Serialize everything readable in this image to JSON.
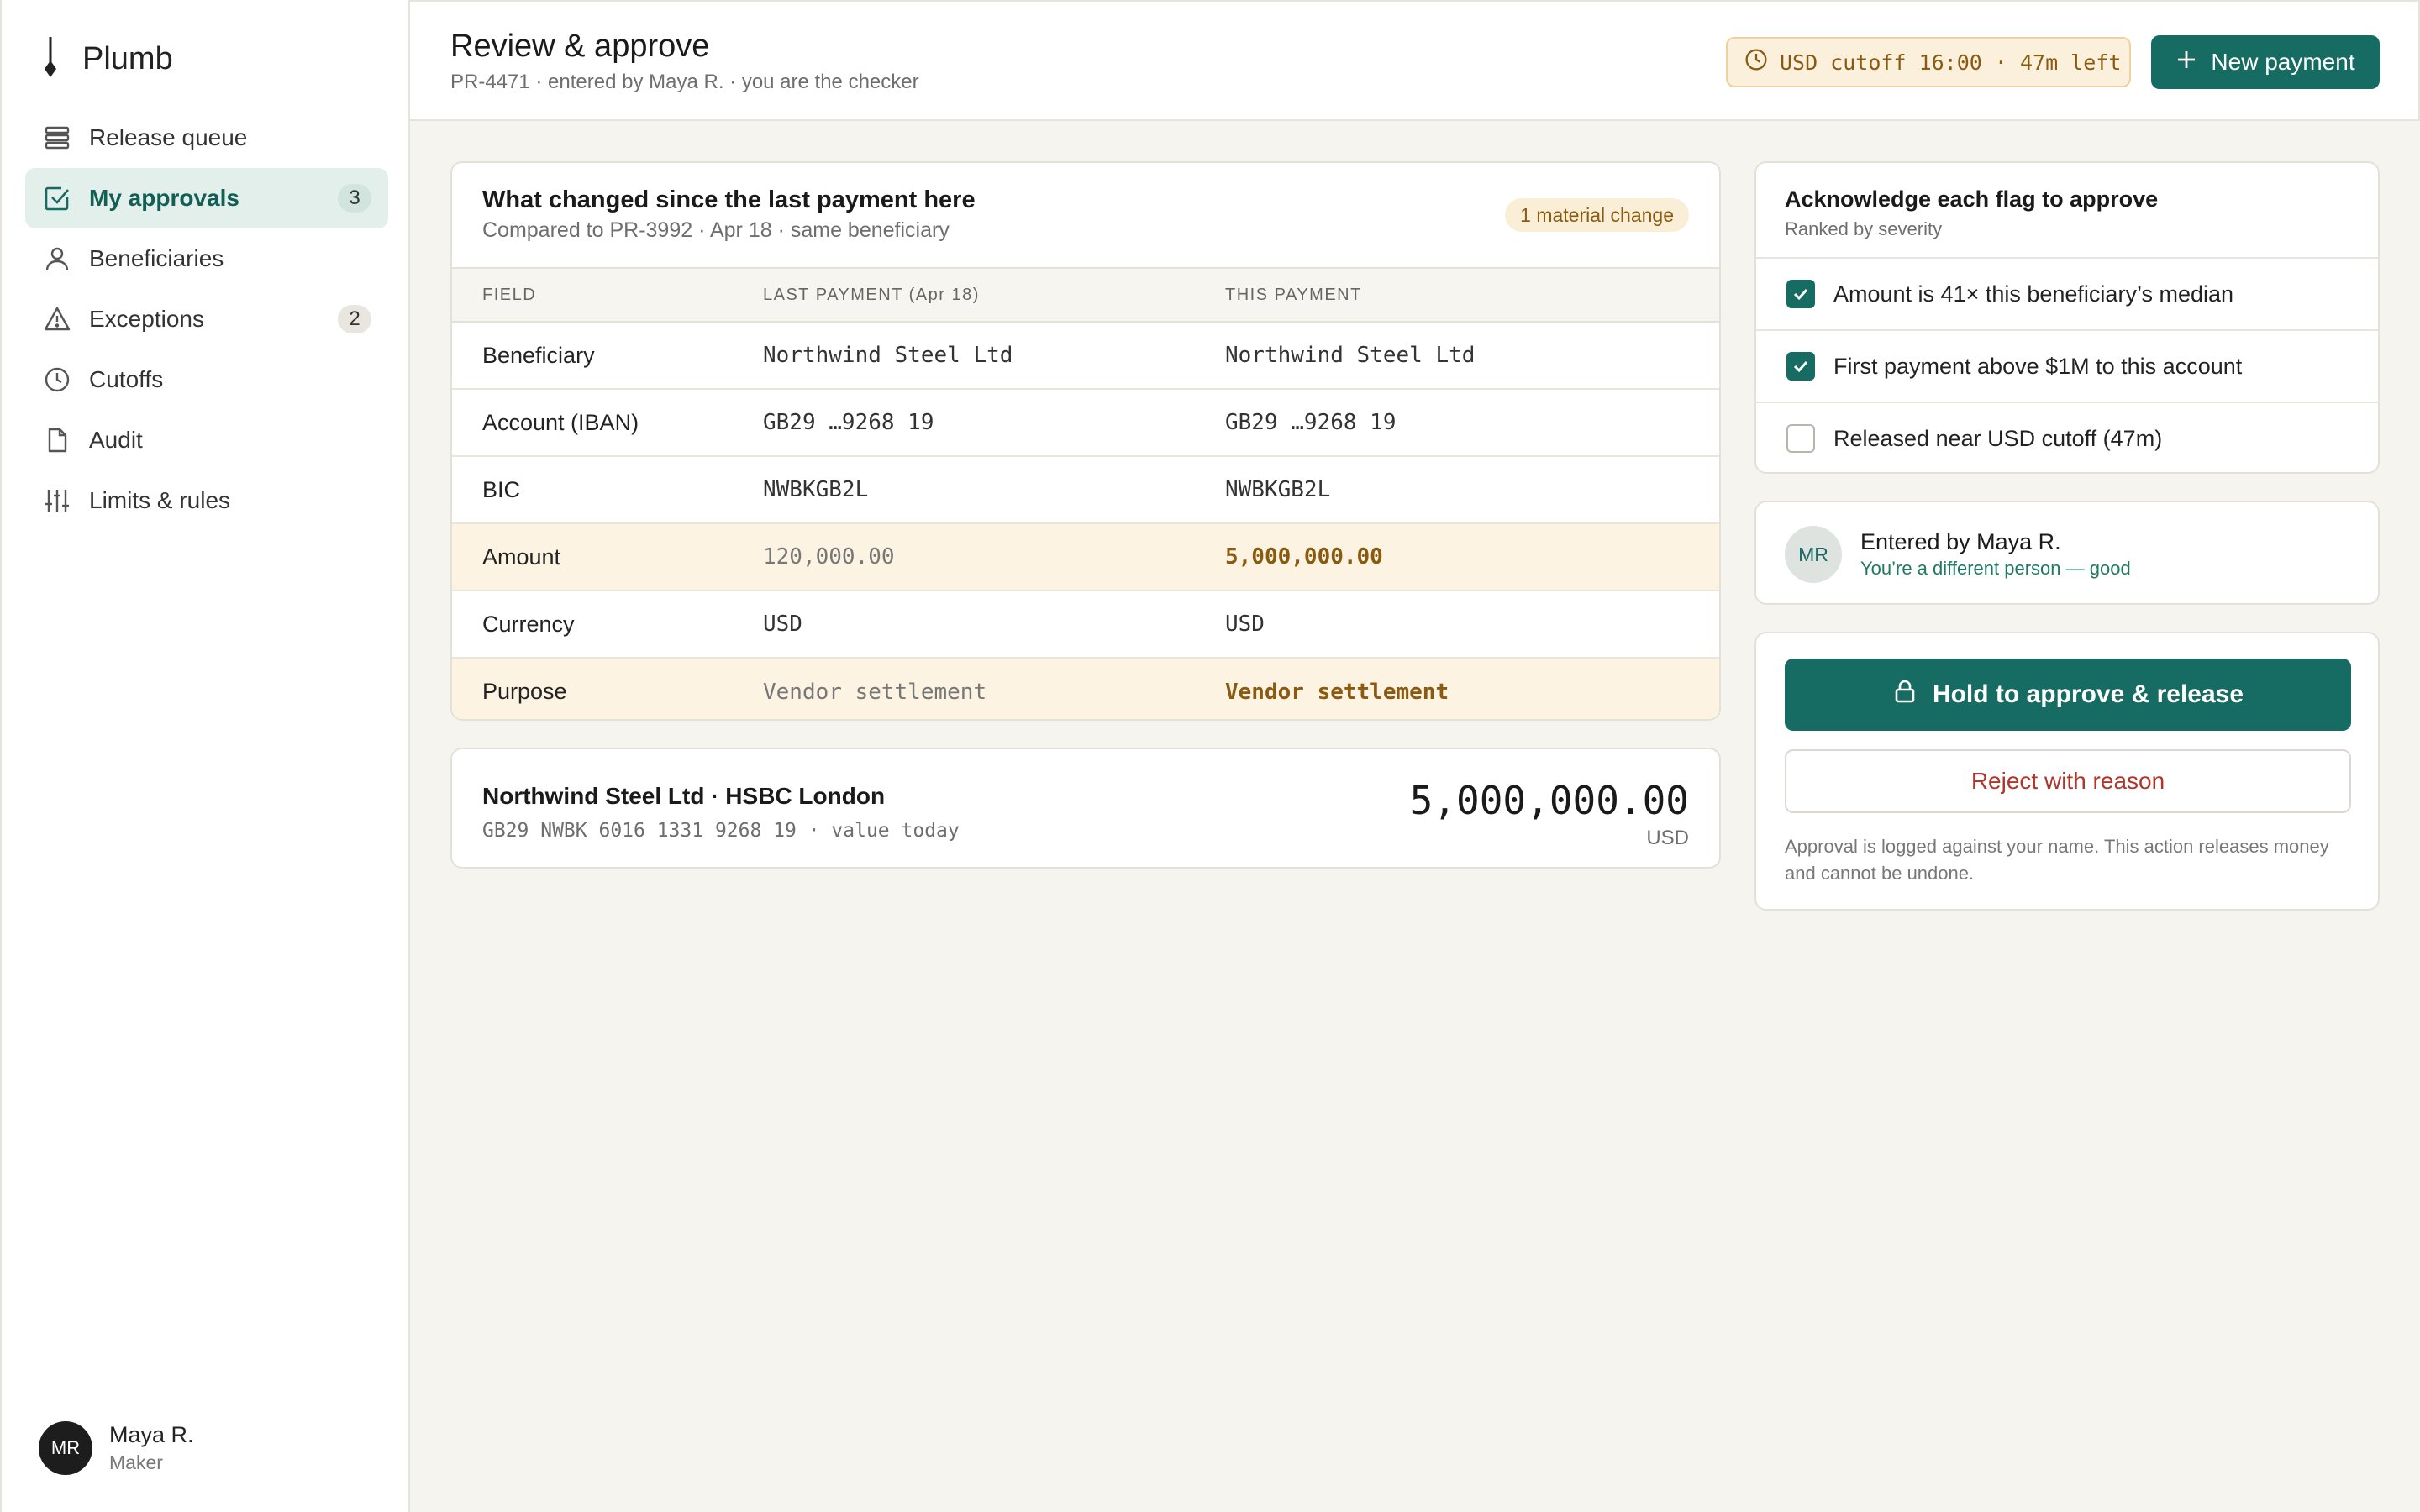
{
  "app": {
    "name": "Plumb"
  },
  "sidebar": {
    "items": [
      {
        "label": "Release queue",
        "icon": "stack-icon",
        "badge": ""
      },
      {
        "label": "My approvals",
        "icon": "check-square-icon",
        "badge": "3",
        "active": true
      },
      {
        "label": "Beneficiaries",
        "icon": "person-icon",
        "badge": ""
      },
      {
        "label": "Exceptions",
        "icon": "warning-icon",
        "badge": "2"
      },
      {
        "label": "Cutoffs",
        "icon": "clock-icon",
        "badge": ""
      },
      {
        "label": "Audit",
        "icon": "document-icon",
        "badge": ""
      },
      {
        "label": "Limits & rules",
        "icon": "sliders-icon",
        "badge": ""
      }
    ],
    "user": {
      "initials": "MR",
      "name": "Maya R.",
      "role": "Maker"
    }
  },
  "header": {
    "title": "Review & approve",
    "subtitle": "PR-4471 · entered by Maya R. · you are the checker",
    "cutoff": "USD cutoff 16:00 · 47m left",
    "new_payment": "New payment"
  },
  "compare": {
    "title": "What changed since the last payment here",
    "subtitle": "Compared to PR-3992 · Apr 18 · same beneficiary",
    "chip": "1 material change",
    "columns": [
      "FIELD",
      "LAST PAYMENT (Apr 18)",
      "THIS PAYMENT"
    ],
    "rows": [
      {
        "field": "Beneficiary",
        "last": "Northwind Steel Ltd",
        "this": "Northwind Steel Ltd",
        "changed": false
      },
      {
        "field": "Account (IBAN)",
        "last": "GB29 …9268 19",
        "this": "GB29 …9268 19",
        "changed": false
      },
      {
        "field": "BIC",
        "last": "NWBKGB2L",
        "this": "NWBKGB2L",
        "changed": false
      },
      {
        "field": "Amount",
        "last": "120,000.00",
        "this": "5,000,000.00",
        "changed": true
      },
      {
        "field": "Currency",
        "last": "USD",
        "this": "USD",
        "changed": false
      },
      {
        "field": "Purpose",
        "last": "Vendor settlement",
        "this": "Vendor settlement",
        "changed": true
      }
    ]
  },
  "beneficiary": {
    "name": "Northwind Steel Ltd · HSBC London",
    "account": "GB29 NWBK 6016 1331 9268 19 · value today",
    "amount": "5,000,000.00",
    "currency": "USD"
  },
  "flags": {
    "title": "Acknowledge each flag to approve",
    "subtitle": "Ranked by severity",
    "items": [
      {
        "label": "Amount is 41× this beneficiary’s median",
        "checked": true
      },
      {
        "label": "First payment above $1M to this account",
        "checked": true
      },
      {
        "label": "Released near USD cutoff (47m)",
        "checked": false
      }
    ]
  },
  "entered": {
    "initials": "MR",
    "name": "Entered by Maya R.",
    "note": "You’re a different person — good"
  },
  "actions": {
    "approve": "Hold to approve & release",
    "reject": "Reject with reason",
    "note": "Approval is logged against your name. This action releases money and cannot be undone."
  },
  "colors": {
    "accent": "#166b62",
    "warning": "#8a5a10",
    "danger": "#b2352a"
  }
}
